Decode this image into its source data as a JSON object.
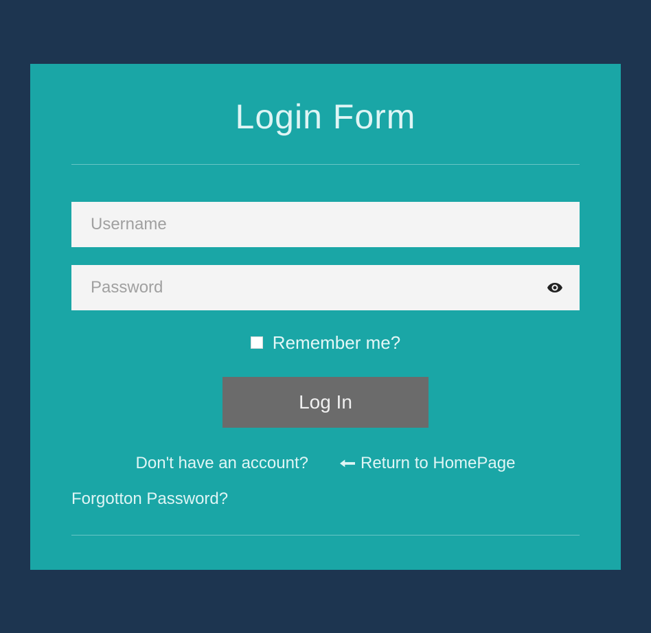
{
  "form": {
    "title": "Login Form",
    "username_placeholder": "Username",
    "password_placeholder": "Password",
    "remember_label": "Remember me?",
    "login_button": "Log In",
    "signup_link": "Don't have an account?",
    "return_link": "Return to HomePage",
    "forgot_link": "Forgotton Password?"
  }
}
